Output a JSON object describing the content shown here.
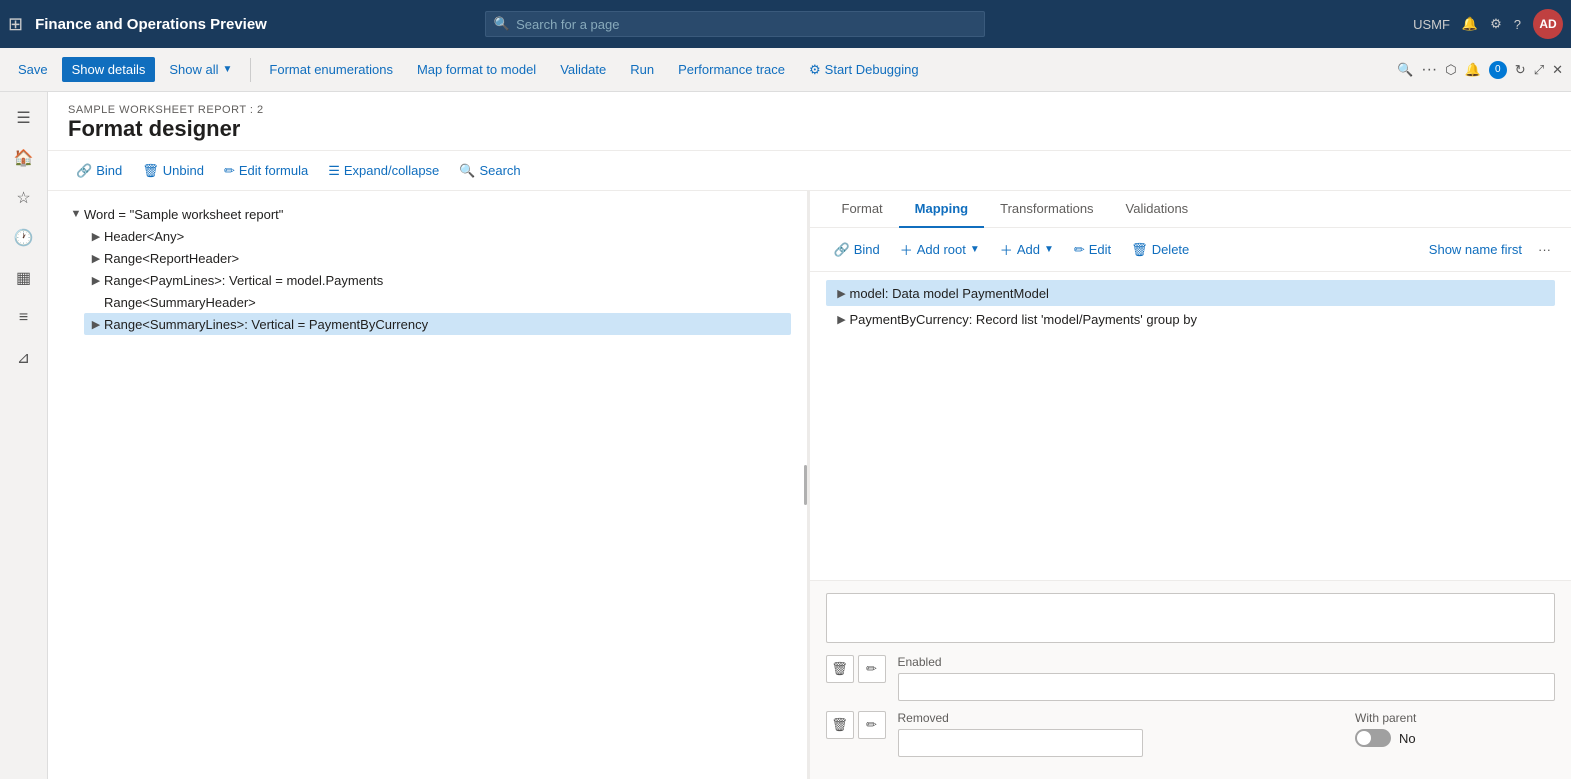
{
  "topNav": {
    "appTitle": "Finance and Operations Preview",
    "searchPlaceholder": "Search for a page",
    "userCode": "USMF",
    "userInitials": "AD"
  },
  "toolbar": {
    "saveLabel": "Save",
    "showDetailsLabel": "Show details",
    "showAllLabel": "Show all",
    "formatEnumerationsLabel": "Format enumerations",
    "mapFormatToModelLabel": "Map format to model",
    "validateLabel": "Validate",
    "runLabel": "Run",
    "performanceTraceLabel": "Performance trace",
    "startDebuggingLabel": "Start Debugging"
  },
  "page": {
    "breadcrumb": "SAMPLE WORKSHEET REPORT : 2",
    "title": "Format designer"
  },
  "secondaryToolbar": {
    "bindLabel": "Bind",
    "unbindLabel": "Unbind",
    "editFormulaLabel": "Edit formula",
    "expandCollapseLabel": "Expand/collapse",
    "searchLabel": "Search"
  },
  "formatTree": {
    "items": [
      {
        "level": 0,
        "label": "Word = \"Sample worksheet report\"",
        "toggle": "▲",
        "selected": false
      },
      {
        "level": 1,
        "label": "Header<Any>",
        "toggle": "▶",
        "selected": false
      },
      {
        "level": 1,
        "label": "Range<ReportHeader>",
        "toggle": "▶",
        "selected": false
      },
      {
        "level": 1,
        "label": "Range<PaymLines>: Vertical = model.Payments",
        "toggle": "▶",
        "selected": false
      },
      {
        "level": 1,
        "label": "Range<SummaryHeader>",
        "toggle": "",
        "selected": false
      },
      {
        "level": 1,
        "label": "Range<SummaryLines>: Vertical = PaymentByCurrency",
        "toggle": "▶",
        "selected": true
      }
    ]
  },
  "tabs": [
    {
      "id": "format",
      "label": "Format"
    },
    {
      "id": "mapping",
      "label": "Mapping"
    },
    {
      "id": "transformations",
      "label": "Transformations"
    },
    {
      "id": "validations",
      "label": "Validations"
    }
  ],
  "mappingToolbar": {
    "bindLabel": "Bind",
    "addRootLabel": "Add root",
    "addLabel": "Add",
    "editLabel": "Edit",
    "deleteLabel": "Delete",
    "showNameFirstLabel": "Show name first"
  },
  "mappingTree": {
    "items": [
      {
        "id": "model",
        "label": "model: Data model PaymentModel",
        "toggle": "▶",
        "selected": true,
        "level": 0
      },
      {
        "id": "payment",
        "label": "PaymentByCurrency: Record list 'model/Payments' group by",
        "toggle": "▶",
        "selected": false,
        "level": 0
      }
    ]
  },
  "bottomForm": {
    "enabledLabel": "Enabled",
    "enabledValue": "",
    "removedLabel": "Removed",
    "removedValue": "",
    "withParentLabel": "With parent",
    "withParentValue": "No",
    "toggleState": "off"
  }
}
